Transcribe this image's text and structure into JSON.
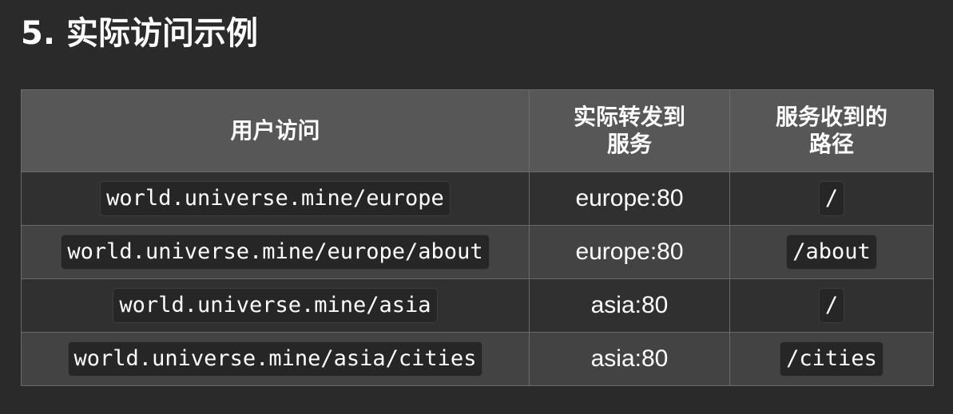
{
  "page": {
    "title": "5. 实际访问示例"
  },
  "table": {
    "headers": [
      "用户访问",
      "实际转发到服务",
      "服务收到的路径"
    ],
    "rows": [
      {
        "url": "world.universe.mine/europe",
        "service": "europe:80",
        "path": "/"
      },
      {
        "url": "world.universe.mine/europe/about",
        "service": "europe:80",
        "path": "/about"
      },
      {
        "url": "world.universe.mine/asia",
        "service": "asia:80",
        "path": "/"
      },
      {
        "url": "world.universe.mine/asia/cities",
        "service": "asia:80",
        "path": "/cities"
      }
    ]
  },
  "colors": {
    "background": "#2a2a2a",
    "header_background": "#575757",
    "row_dark": "#303030",
    "row_light": "#434343",
    "code_background": "#262626",
    "border": "#6b6b6b",
    "text": "#ffffff"
  }
}
